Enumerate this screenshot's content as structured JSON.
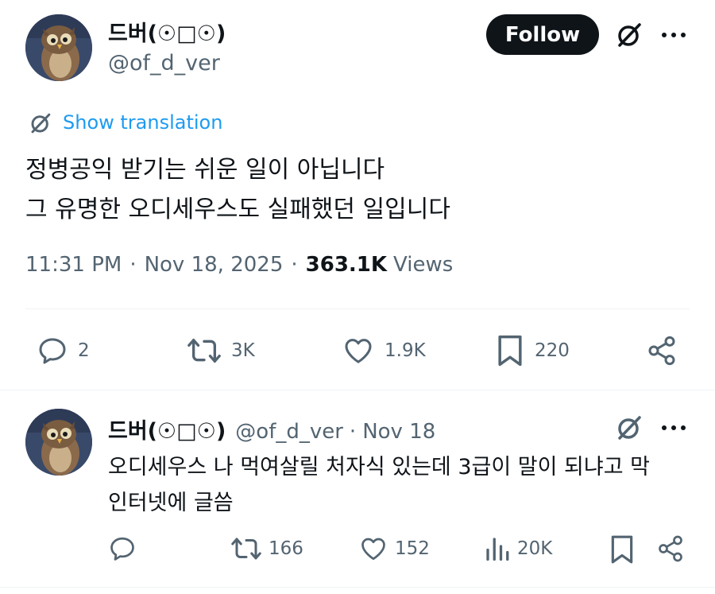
{
  "main_tweet": {
    "display_name": "드버(☉□☉)",
    "handle": "@of_d_ver",
    "follow_label": "Follow",
    "show_translation": "Show translation",
    "lines": [
      "정병공익 받기는 쉬운 일이 아닙니다",
      "그 유명한 오디세우스도 실패했던 일입니다"
    ],
    "time": "11:31 PM",
    "date": "Nov 18, 2025",
    "sep": "·",
    "views_count": "363.1K",
    "views_label": "Views",
    "replies": "2",
    "reposts": "3K",
    "likes": "1.9K",
    "bookmarks": "220"
  },
  "reply_tweet": {
    "display_name": "드버(☉□☉)",
    "handle": "@of_d_ver",
    "sep": "·",
    "date": "Nov 18",
    "lines": [
      "오디세우스 나 먹여살릴 처자식 있는데 3급이 말이 되냐고 막",
      "인터넷에 글씀"
    ],
    "reposts": "166",
    "likes": "152",
    "views": "20K"
  },
  "colors": {
    "text": "#0f1419",
    "muted": "#536471",
    "link": "#1d9bf0",
    "divider": "#eff3f4"
  }
}
